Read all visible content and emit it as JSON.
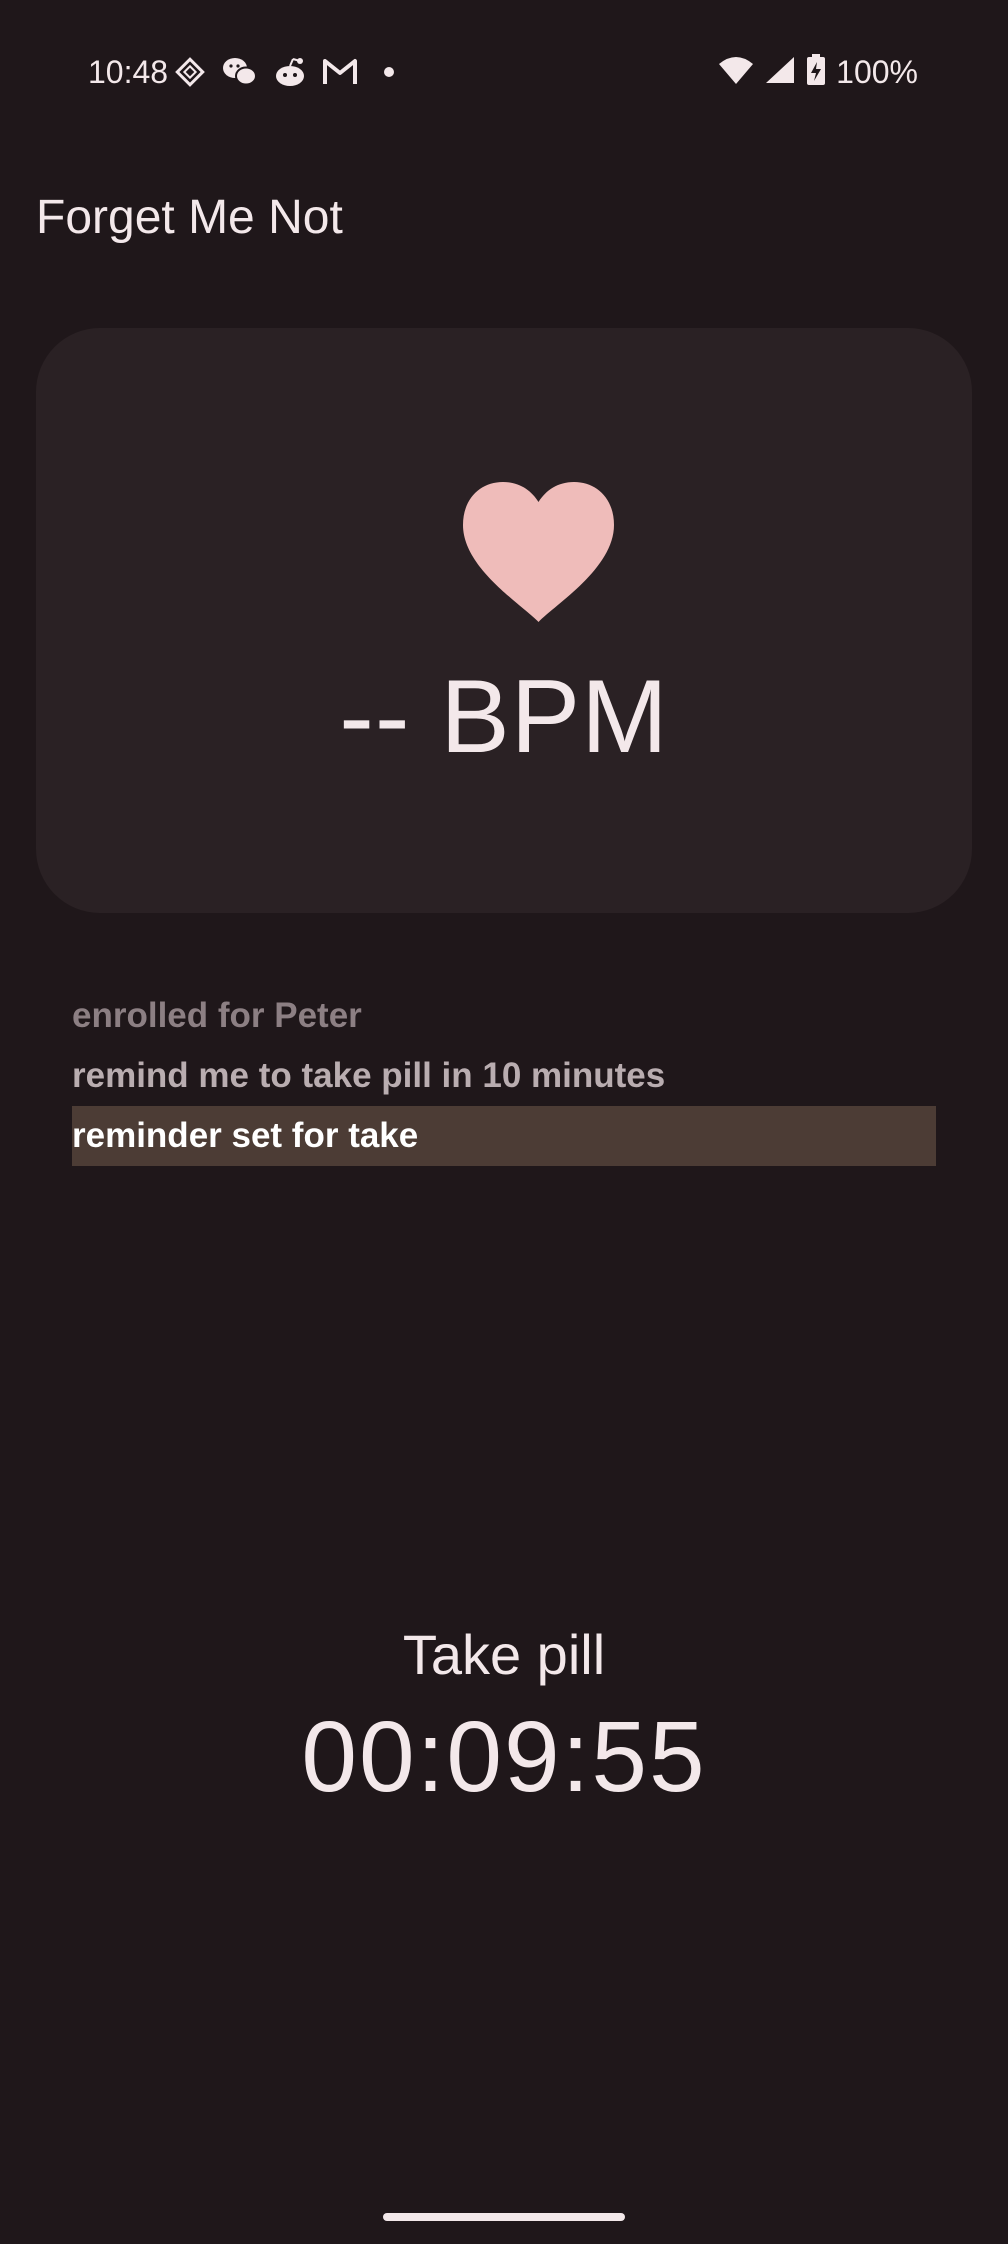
{
  "status_bar": {
    "time": "10:48",
    "battery": "100%",
    "left_icons": [
      "app-icon",
      "wechat-icon",
      "reddit-icon",
      "gmail-icon",
      "dot-icon"
    ],
    "right_icons": [
      "wifi-icon",
      "signal-icon",
      "battery-charging-icon"
    ]
  },
  "app": {
    "title": "Forget Me Not"
  },
  "heart_card": {
    "icon": "heart-icon",
    "bpm_text": "-- BPM",
    "heart_color": "#efbcba"
  },
  "conversation": {
    "lines": [
      "enrolled for Peter",
      "remind me to take pill in 10 minutes",
      "reminder set for take"
    ]
  },
  "reminder": {
    "title": "Take pill",
    "countdown": "00:09:55"
  },
  "colors": {
    "background": "#1f171a",
    "card": "#2a2124",
    "highlight": "#4c3c35",
    "text": "#f3e8ea"
  }
}
